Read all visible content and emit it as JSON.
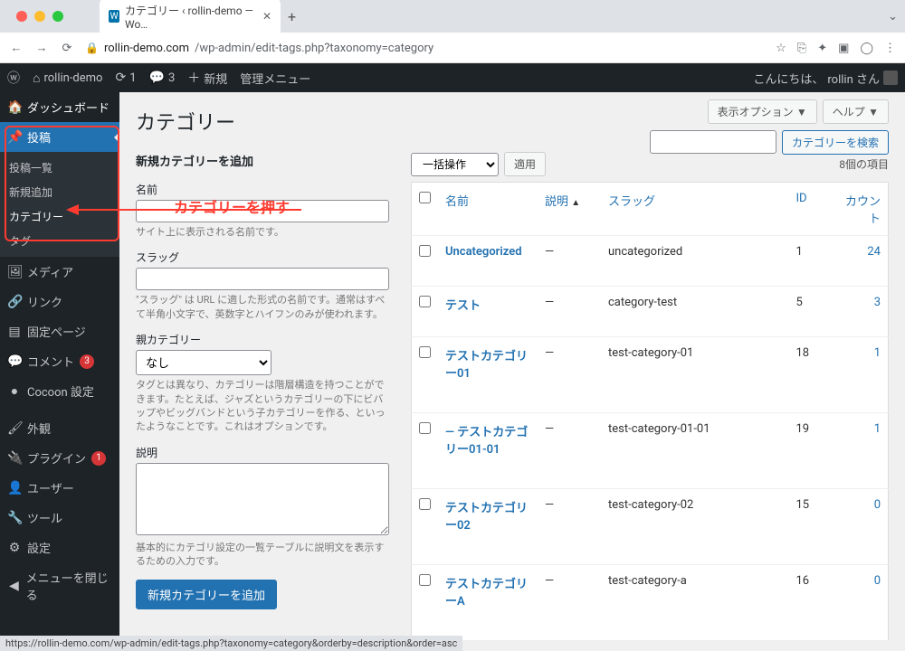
{
  "browser": {
    "tab_title": "カテゴリー ‹ rollin-demo — Wo…",
    "url_prefix": "rollin-demo.com",
    "url_path": "/wp-admin/edit-tags.php?taxonomy=category",
    "status_url": "https://rollin-demo.com/wp-admin/edit-tags.php?taxonomy=category&orderby=description&order=asc"
  },
  "adminbar": {
    "site": "rollin-demo",
    "refresh": "1",
    "comments": "3",
    "new": "新規",
    "manage_menu": "管理メニュー",
    "greeting": "こんにちは、",
    "user": "rollin さん"
  },
  "sidebar": {
    "dashboard": "ダッシュボード",
    "posts": "投稿",
    "posts_sub": [
      "投稿一覧",
      "新規追加",
      "カテゴリー",
      "タグ"
    ],
    "media": "メディア",
    "links": "リンク",
    "pages": "固定ページ",
    "comments": "コメント",
    "comments_badge": "3",
    "cocoon": "Cocoon 設定",
    "appearance": "外観",
    "plugins": "プラグイン",
    "plugins_badge": "1",
    "users": "ユーザー",
    "tools": "ツール",
    "settings": "設定",
    "collapse": "メニューを閉じる"
  },
  "annotation": "カテゴリーを押す",
  "page": {
    "title": "カテゴリー",
    "screen_options": "表示オプション ▼",
    "help": "ヘルプ ▼"
  },
  "form": {
    "heading": "新規カテゴリーを追加",
    "name_label": "名前",
    "name_help": "サイト上に表示される名前です。",
    "slug_label": "スラッグ",
    "slug_help": "\"スラッグ\" は URL に適した形式の名前です。通常はすべて半角小文字で、英数字とハイフンのみが使われます。",
    "parent_label": "親カテゴリー",
    "parent_option": "なし",
    "parent_help": "タグとは異なり、カテゴリーは階層構造を持つことができます。たとえば、ジャズというカテゴリーの下にビバップやビッグバンドという子カテゴリーを作る、といったようなことです。これはオプションです。",
    "desc_label": "説明",
    "desc_help": "基本的にカテゴリ設定の一覧テーブルに説明文を表示するための入力です。",
    "submit": "新規カテゴリーを追加"
  },
  "table": {
    "search_label": "カテゴリーを検索",
    "bulk_label": "一括操作",
    "apply": "適用",
    "items_count": "8個の項目",
    "columns": {
      "name": "名前",
      "desc": "説明",
      "slug": "スラッグ",
      "id": "ID",
      "count": "カウント"
    },
    "rows": [
      {
        "name": "Uncategorized",
        "desc": "—",
        "slug": "uncategorized",
        "id": "1",
        "count": "24"
      },
      {
        "name": "テスト",
        "desc": "—",
        "slug": "category-test",
        "id": "5",
        "count": "3"
      },
      {
        "name": "テストカテゴリー01",
        "desc": "—",
        "slug": "test-category-01",
        "id": "18",
        "count": "1"
      },
      {
        "name": "— テストカテゴリー01-01",
        "desc": "—",
        "slug": "test-category-01-01",
        "id": "19",
        "count": "1"
      },
      {
        "name": "テストカテゴリー02",
        "desc": "—",
        "slug": "test-category-02",
        "id": "15",
        "count": "0"
      },
      {
        "name": "テストカテゴリーA",
        "desc": "—",
        "slug": "test-category-a",
        "id": "16",
        "count": "0"
      }
    ]
  }
}
